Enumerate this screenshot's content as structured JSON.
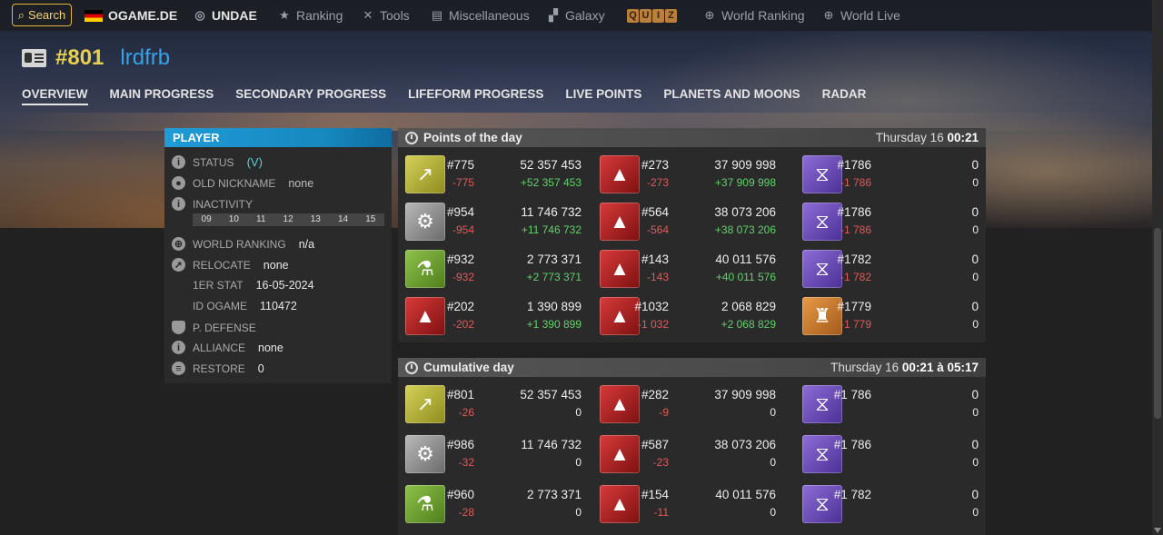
{
  "nav": {
    "search": "Search",
    "items": [
      "OGAME.DE",
      "UNDAE",
      "Ranking",
      "Tools",
      "Miscellaneous",
      "Galaxy",
      "World Ranking",
      "World Live"
    ],
    "quiz": [
      "Q",
      "U",
      "I",
      "Z"
    ]
  },
  "player": {
    "rank": "#801",
    "name": "lrdfrb"
  },
  "tabs": [
    "OVERVIEW",
    "MAIN PROGRESS",
    "SECONDARY PROGRESS",
    "LIFEFORM PROGRESS",
    "LIVE POINTS",
    "PLANETS AND MOONS",
    "RADAR"
  ],
  "panel": {
    "title": "PLAYER",
    "status_label": "STATUS",
    "status_value": "(V)",
    "old_nick_label": "OLD NICKNAME",
    "old_nick_value": "none",
    "inactivity_label": "INACTIVITY",
    "days": [
      "09",
      "10",
      "11",
      "12",
      "13",
      "14",
      "15"
    ],
    "world_rank_label": "WORLD RANKING",
    "world_rank_value": "n/a",
    "relocate_label": "RELOCATE",
    "relocate_value": "none",
    "first_stat_label": "1ER STAT",
    "first_stat_value": "16-05-2024",
    "id_label": "ID OGAME",
    "id_value": "110472",
    "defense_label": "P. DEFENSE",
    "alliance_label": "ALLIANCE",
    "alliance_value": "none",
    "restore_label": "RESTORE",
    "restore_value": "0"
  },
  "points_day": {
    "title": "Points of the day",
    "date": "Thursday 16",
    "time": "00:21",
    "rows": [
      [
        {
          "icon": "yellow",
          "rank": "#775",
          "points": "52 357 453",
          "drank": "-775",
          "dpoints": "+52 357 453"
        },
        {
          "icon": "red",
          "rank": "#273",
          "points": "37 909 998",
          "drank": "-273",
          "dpoints": "+37 909 998"
        },
        {
          "icon": "purple",
          "rank": "#1786",
          "points": "0",
          "drank": "-1 786",
          "dpoints": "0"
        }
      ],
      [
        {
          "icon": "gray",
          "rank": "#954",
          "points": "11 746 732",
          "drank": "-954",
          "dpoints": "+11 746 732"
        },
        {
          "icon": "red",
          "rank": "#564",
          "points": "38 073 206",
          "drank": "-564",
          "dpoints": "+38 073 206"
        },
        {
          "icon": "purple",
          "rank": "#1786",
          "points": "0",
          "drank": "-1 786",
          "dpoints": "0"
        }
      ],
      [
        {
          "icon": "green",
          "rank": "#932",
          "points": "2 773 371",
          "drank": "-932",
          "dpoints": "+2 773 371"
        },
        {
          "icon": "red",
          "rank": "#143",
          "points": "40 011 576",
          "drank": "-143",
          "dpoints": "+40 011 576"
        },
        {
          "icon": "purple",
          "rank": "#1782",
          "points": "0",
          "drank": "-1 782",
          "dpoints": "0"
        }
      ],
      [
        {
          "icon": "red",
          "rank": "#202",
          "points": "1 390 899",
          "drank": "-202",
          "dpoints": "+1 390 899"
        },
        {
          "icon": "red",
          "rank": "#1032",
          "points": "2 068 829",
          "drank": "-1 032",
          "dpoints": "+2 068 829"
        },
        {
          "icon": "orange",
          "rank": "#1779",
          "points": "0",
          "drank": "-1 779",
          "dpoints": "0"
        }
      ]
    ]
  },
  "cumulative": {
    "title": "Cumulative day",
    "date": "Thursday 16",
    "time": "00:21 à 05:17",
    "rows": [
      [
        {
          "icon": "yellow",
          "rank": "#801",
          "points": "52 357 453",
          "drank": "-26",
          "dpoints": "0"
        },
        {
          "icon": "red",
          "rank": "#282",
          "points": "37 909 998",
          "drank": "-9",
          "dpoints": "0"
        },
        {
          "icon": "purple",
          "rank": "#1 786",
          "points": "0",
          "drank": "",
          "dpoints": "0"
        }
      ],
      [
        {
          "icon": "gray",
          "rank": "#986",
          "points": "11 746 732",
          "drank": "-32",
          "dpoints": "0"
        },
        {
          "icon": "red",
          "rank": "#587",
          "points": "38 073 206",
          "drank": "-23",
          "dpoints": "0"
        },
        {
          "icon": "purple",
          "rank": "#1 786",
          "points": "0",
          "drank": "",
          "dpoints": "0"
        }
      ],
      [
        {
          "icon": "green",
          "rank": "#960",
          "points": "2 773 371",
          "drank": "-28",
          "dpoints": "0"
        },
        {
          "icon": "red",
          "rank": "#154",
          "points": "40 011 576",
          "drank": "-11",
          "dpoints": "0"
        },
        {
          "icon": "purple",
          "rank": "#1 782",
          "points": "0",
          "drank": "",
          "dpoints": "0"
        }
      ]
    ]
  }
}
